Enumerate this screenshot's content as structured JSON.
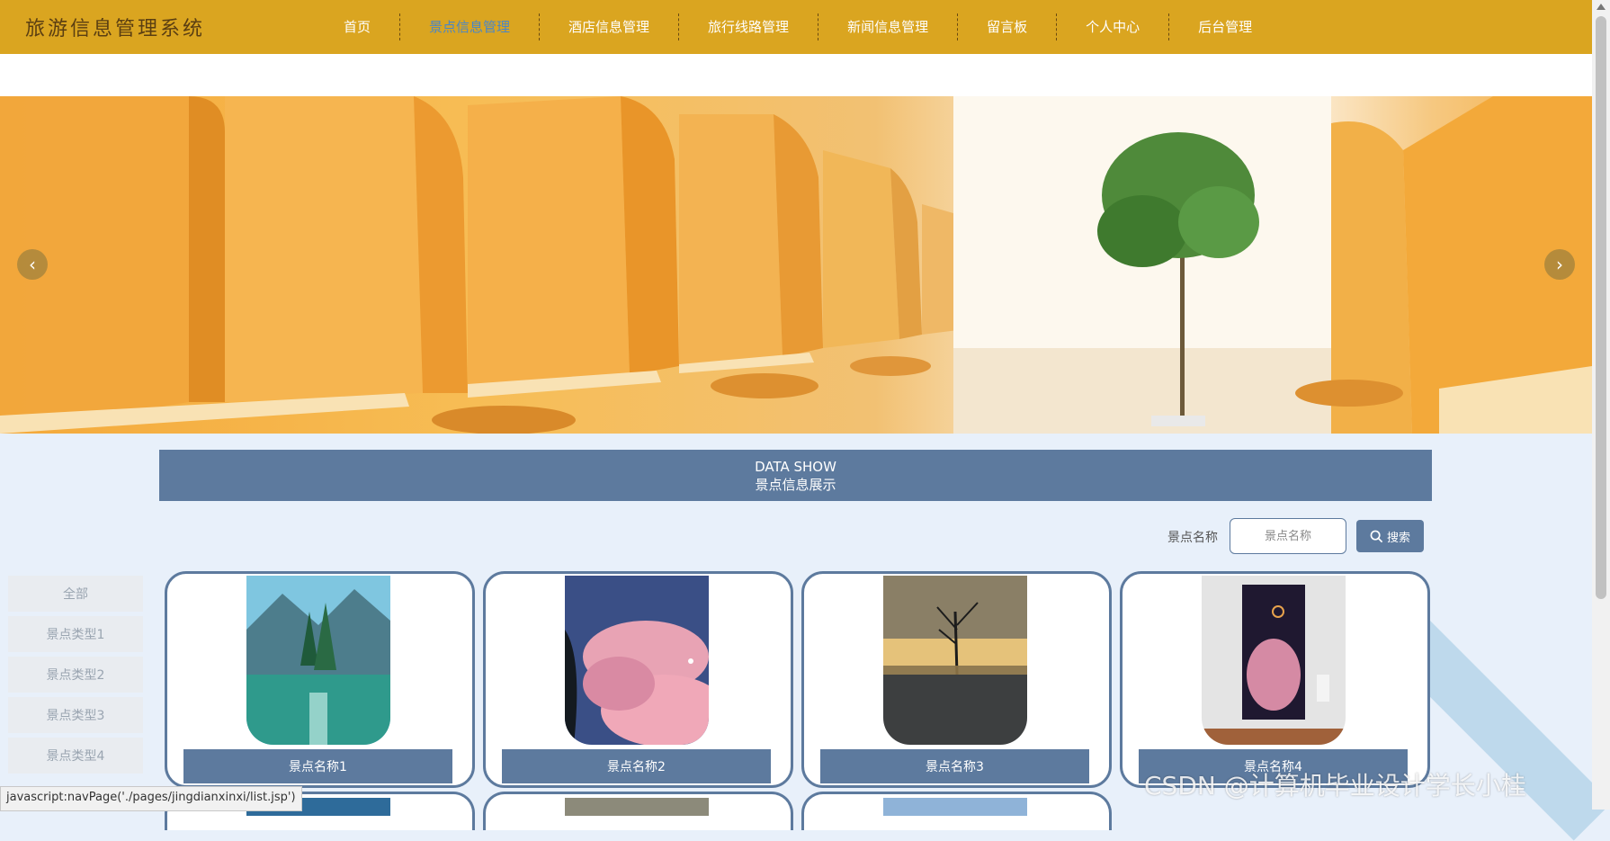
{
  "header": {
    "logo": "旅游信息管理系统",
    "nav": [
      {
        "label": "首页",
        "active": false
      },
      {
        "label": "景点信息管理",
        "active": true
      },
      {
        "label": "酒店信息管理",
        "active": false
      },
      {
        "label": "旅行线路管理",
        "active": false
      },
      {
        "label": "新闻信息管理",
        "active": false
      },
      {
        "label": "留言板",
        "active": false
      },
      {
        "label": "个人中心",
        "active": false
      },
      {
        "label": "后台管理",
        "active": false
      }
    ]
  },
  "section": {
    "title_en": "DATA SHOW",
    "title_cn": "景点信息展示"
  },
  "search": {
    "label": "景点名称",
    "placeholder": "景点名称",
    "button_label": "搜索"
  },
  "categories": [
    "全部",
    "景点类型1",
    "景点类型2",
    "景点类型3",
    "景点类型4"
  ],
  "cards": [
    {
      "name": "景点名称1"
    },
    {
      "name": "景点名称2"
    },
    {
      "name": "景点名称3"
    },
    {
      "name": "景点名称4"
    }
  ],
  "status_url": "javascript:navPage('./pages/jingdianxinxi/list.jsp')",
  "watermark": "CSDN @计算机毕业设计学长小桂",
  "colors": {
    "header_bg": "#daa520",
    "accent": "#5d7a9e",
    "active_nav": "#4a86c8",
    "page_bg": "#e8f0fa"
  }
}
